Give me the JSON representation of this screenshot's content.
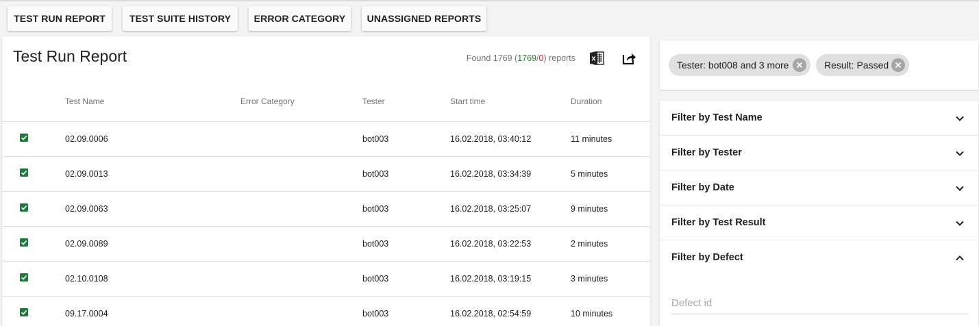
{
  "nav": {
    "buttons": [
      {
        "label": "TEST RUN REPORT"
      },
      {
        "label": "TEST SUITE HISTORY"
      },
      {
        "label": "ERROR CATEGORY"
      },
      {
        "label": "UNASSIGNED REPORTS"
      }
    ]
  },
  "report": {
    "title": "Test Run Report",
    "found_prefix": "Found 1769 (",
    "found_passed": "1769",
    "found_sep": "/",
    "found_failed": "0",
    "found_suffix": ") reports",
    "columns": [
      "Test Name",
      "Error Category",
      "Tester",
      "Start time",
      "Duration"
    ],
    "rows": [
      {
        "test_name": "02.09.0006",
        "error_category": "",
        "tester": "bot003",
        "start_time": "16.02.2018, 03:40:12",
        "duration": "11 minutes"
      },
      {
        "test_name": "02.09.0013",
        "error_category": "",
        "tester": "bot003",
        "start_time": "16.02.2018, 03:34:39",
        "duration": "5 minutes"
      },
      {
        "test_name": "02.09.0063",
        "error_category": "",
        "tester": "bot003",
        "start_time": "16.02.2018, 03:25:07",
        "duration": "9 minutes"
      },
      {
        "test_name": "02.09.0089",
        "error_category": "",
        "tester": "bot003",
        "start_time": "16.02.2018, 03:22:53",
        "duration": "2 minutes"
      },
      {
        "test_name": "02.10.0108",
        "error_category": "",
        "tester": "bot003",
        "start_time": "16.02.2018, 03:19:15",
        "duration": "3 minutes"
      },
      {
        "test_name": "09.17.0004",
        "error_category": "",
        "tester": "bot003",
        "start_time": "16.02.2018, 02:54:59",
        "duration": "10 minutes"
      }
    ],
    "icons": {
      "excel": "excel-export-icon",
      "share": "share-export-icon",
      "status": "passed-check-icon"
    }
  },
  "chips": [
    {
      "label": "Tester: bot008 and 3 more"
    },
    {
      "label": "Result: Passed"
    }
  ],
  "filters": {
    "items": [
      {
        "label": "Filter by Test Name",
        "expanded": false
      },
      {
        "label": "Filter by Tester",
        "expanded": false
      },
      {
        "label": "Filter by Date",
        "expanded": false
      },
      {
        "label": "Filter by Test Result",
        "expanded": false
      },
      {
        "label": "Filter by Defect",
        "expanded": true
      }
    ],
    "defect_placeholder": "Defect id",
    "defect_value": ""
  },
  "colors": {
    "passed": "#2e7d32",
    "failed": "#c62828",
    "check": "#1e7a3c",
    "chip_bg": "#e0e0e0"
  }
}
